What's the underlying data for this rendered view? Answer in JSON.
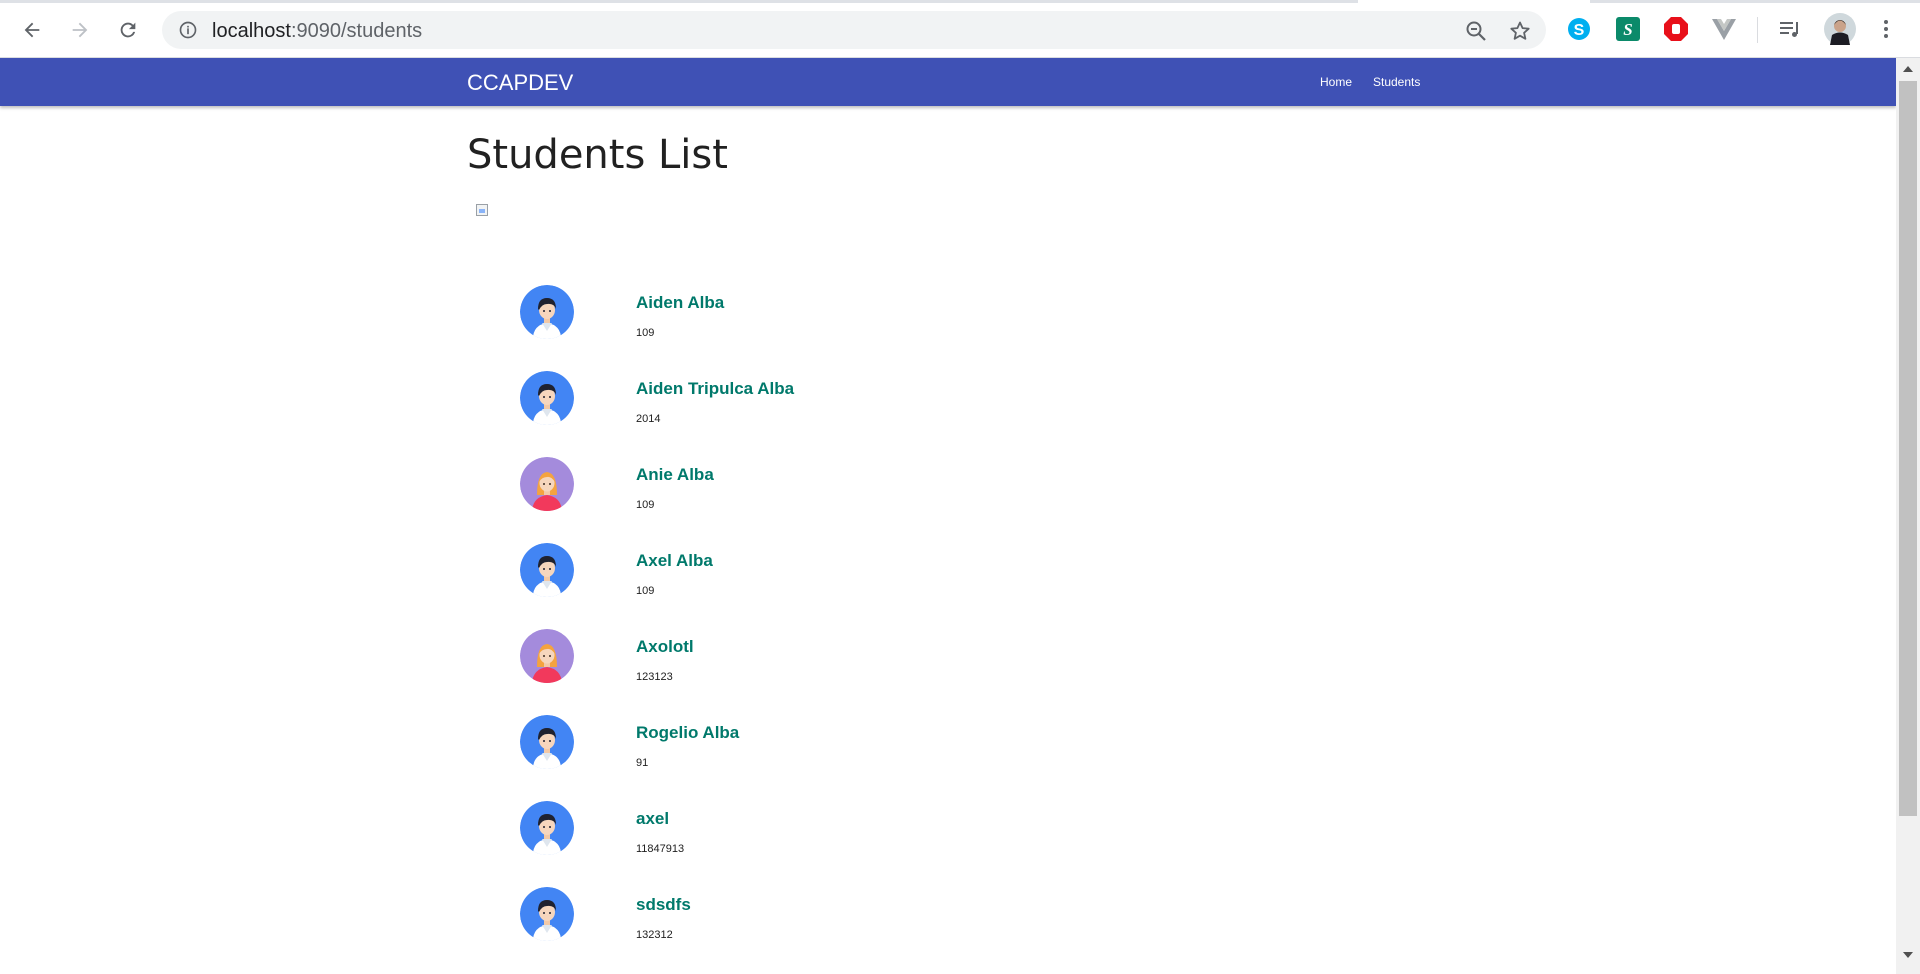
{
  "browser": {
    "url_host": "localhost",
    "url_path": ":9090/students",
    "icons": [
      "back-arrow-icon",
      "forward-arrow-icon",
      "reload-icon",
      "info-icon",
      "zoom-out-icon",
      "star-icon",
      "skype-icon",
      "script-icon",
      "stop-icon",
      "vue-icon",
      "media-icon",
      "profile-avatar-icon",
      "menu-dots-icon"
    ]
  },
  "navbar": {
    "brand": "CCAPDEV",
    "links": [
      "Home",
      "Students"
    ],
    "color": "#3f51b5"
  },
  "page": {
    "title": "Students List"
  },
  "students": [
    {
      "name": "Aiden Alba",
      "id": "109",
      "avatar": "male"
    },
    {
      "name": "Aiden Tripulca Alba",
      "id": "2014",
      "avatar": "male"
    },
    {
      "name": "Anie Alba",
      "id": "109",
      "avatar": "female"
    },
    {
      "name": "Axel Alba",
      "id": "109",
      "avatar": "male"
    },
    {
      "name": "Axolotl",
      "id": "123123",
      "avatar": "female"
    },
    {
      "name": "Rogelio Alba",
      "id": "91",
      "avatar": "male"
    },
    {
      "name": "axel",
      "id": "11847913",
      "avatar": "male"
    },
    {
      "name": "sdsdfs",
      "id": "132312",
      "avatar": "male"
    }
  ],
  "colors": {
    "name": "#00796b",
    "male_avatar_bg": "#4285f4",
    "female_avatar_bg": "#a48bdc"
  }
}
